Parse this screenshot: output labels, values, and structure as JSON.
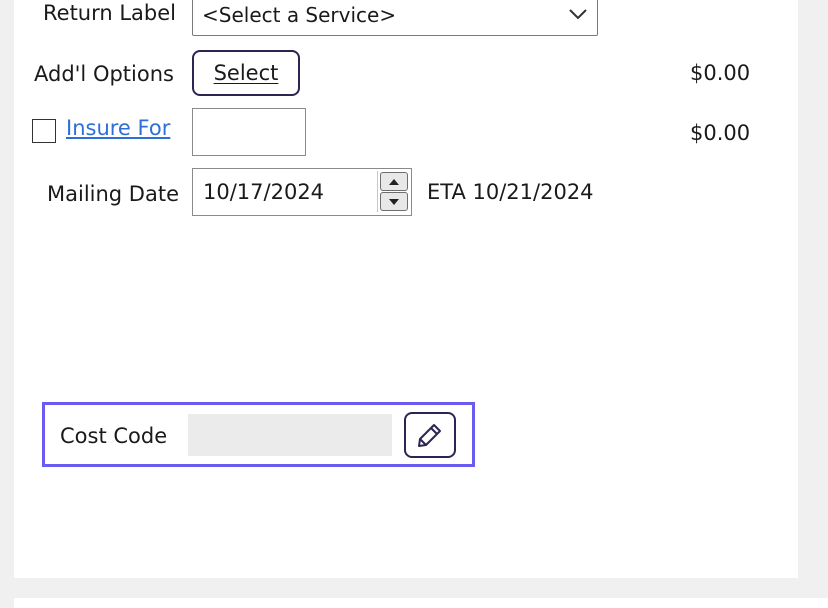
{
  "return_label": {
    "label": "Return Label",
    "selected_value": "<Select a Service>"
  },
  "addl_options": {
    "label": "Add'l Options",
    "button_label": "Select",
    "price": "$0.00"
  },
  "insure": {
    "checked": false,
    "link_label": "Insure For",
    "value": "",
    "price": "$0.00"
  },
  "mailing_date": {
    "label": "Mailing Date",
    "value": "10/17/2024",
    "eta": "ETA 10/21/2024"
  },
  "cost_code": {
    "label": "Cost Code",
    "value": ""
  },
  "colors": {
    "focus_border": "#6a5cf0",
    "link": "#2d6fd6",
    "button_border": "#2c2552"
  }
}
